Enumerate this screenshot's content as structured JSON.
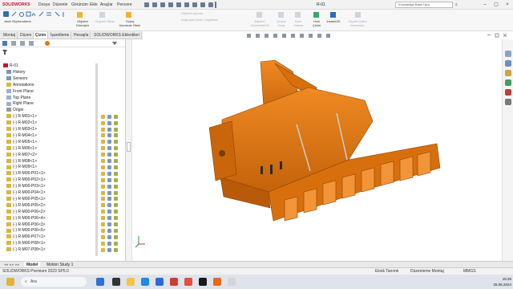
{
  "app": {
    "brand": "SOLIDWORKS",
    "window_title": "R-01",
    "menus": [
      "Dosya",
      "Düzenle",
      "Görünüm",
      "Ekle",
      "Araçlar",
      "Pencere"
    ],
    "search_placeholder": "Knowledge Base'i Ara"
  },
  "ribbon": {
    "items": [
      {
        "label": "Akıllı Ölçülendirme",
        "dim": false
      },
      {
        "label": "Objeleri Dönüştür",
        "dim": false
      },
      {
        "label": "Objeleri Ötele",
        "dim": true
      },
      {
        "label": "Yüzey Üzerinde Ötele",
        "dim": false
      },
      {
        "label": "Objeleri Aynala",
        "dim": true
      },
      {
        "label": "Doğrusal Çizim Çoğaltma",
        "dim": true
      },
      {
        "label": "İlişkileri Görüntüle/Sil",
        "dim": true
      },
      {
        "label": "Çizimi Onar",
        "dim": true
      },
      {
        "label": "Hızlı Yakala",
        "dim": true
      },
      {
        "label": "Hızlı Çizim",
        "dim": false
      },
      {
        "label": "Instant2D",
        "dim": false
      },
      {
        "label": "Ölçekli Çizim Konturları",
        "dim": true
      }
    ]
  },
  "tabs": [
    "Montaj",
    "Düzen",
    "Çizim",
    "İşaretleme",
    "Hesapla",
    "SOLIDWORKS Eklentileri"
  ],
  "active_tab": "Çizim",
  "tree": {
    "root": "R-01",
    "folders": [
      "History",
      "Sensors",
      "Annotations",
      "Front Plane",
      "Top Plane",
      "Right Plane",
      "Origin"
    ],
    "components": [
      "(-) R-M01<1>",
      "(-) R-M02<1>",
      "(-) R-M03<1>",
      "(-) R-M04<1>",
      "(-) R-M05<1>",
      "(-) R-M06<1>",
      "(-) R-M07<2>",
      "(-) R-M08<1>",
      "(-) R-M09<1>",
      "(-) R-M00-P01<1>",
      "(-) R-M00-P02<1>",
      "(-) R-M00-P03<1>",
      "(-) R-M00-P04<1>",
      "(-) R-M00-P05<1>",
      "(-) R-M00-P05<2>",
      "(-) R-M00-P06<2>",
      "(-) R-M00-P06<4>",
      "(-) R-M00-P06<3>",
      "(-) R-M00-P06<5>",
      "(-) R-M00-P07<1>",
      "(-) R-M00-P08<1>",
      "(-) R-M07-P08<1>"
    ]
  },
  "bottom_tabs": [
    "Model",
    "Motion Study 1"
  ],
  "active_bottom_tab": "Model",
  "status": {
    "product": "SOLIDWORKS Premium 2023 SP5.0",
    "state": "Eksik Tanımlı",
    "mode": "Düzenleme Montaj",
    "units": "MMGS"
  },
  "taskbar": {
    "search_placeholder": "Ara",
    "time": "15:29",
    "date": "25.06.2024"
  },
  "colors": {
    "model_orange": "#e0760f",
    "model_shadow": "#a9520a",
    "brand_red": "#c8102e",
    "highlight_blue": "#1a73e8"
  },
  "icons": {
    "graphics_hud": [
      "zoom-to-fit-icon",
      "zoom-area-icon",
      "previous-view-icon",
      "section-view-icon",
      "view-orientation-icon",
      "display-style-icon",
      "hide-show-icon",
      "appearance-icon",
      "scene-icon",
      "view-settings-icon"
    ]
  }
}
